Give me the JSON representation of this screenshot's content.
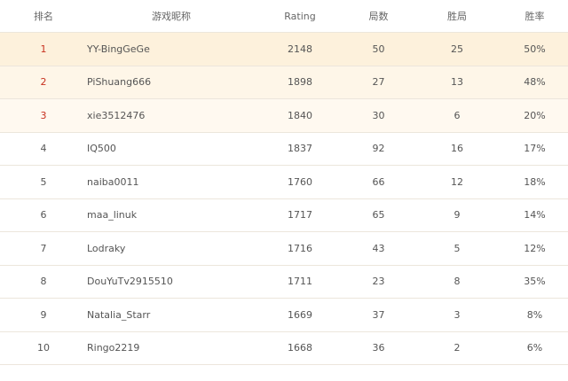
{
  "headers": {
    "rank": "排名",
    "name": "游戏昵称",
    "rating": "Rating",
    "games": "局数",
    "wins": "胜局",
    "rate": "胜率"
  },
  "rows": [
    {
      "rank": "1",
      "name": "YY-BingGeGe",
      "rating": "2148",
      "games": "50",
      "wins": "25",
      "rate": "50%"
    },
    {
      "rank": "2",
      "name": "PiShuang666",
      "rating": "1898",
      "games": "27",
      "wins": "13",
      "rate": "48%"
    },
    {
      "rank": "3",
      "name": "xie3512476",
      "rating": "1840",
      "games": "30",
      "wins": "6",
      "rate": "20%"
    },
    {
      "rank": "4",
      "name": "IQ500",
      "rating": "1837",
      "games": "92",
      "wins": "16",
      "rate": "17%"
    },
    {
      "rank": "5",
      "name": "naiba0011",
      "rating": "1760",
      "games": "66",
      "wins": "12",
      "rate": "18%"
    },
    {
      "rank": "6",
      "name": "maa_linuk",
      "rating": "1717",
      "games": "65",
      "wins": "9",
      "rate": "14%"
    },
    {
      "rank": "7",
      "name": "Lodraky",
      "rating": "1716",
      "games": "43",
      "wins": "5",
      "rate": "12%"
    },
    {
      "rank": "8",
      "name": "DouYuTv2915510",
      "rating": "1711",
      "games": "23",
      "wins": "8",
      "rate": "35%"
    },
    {
      "rank": "9",
      "name": "Natalia_Starr",
      "rating": "1669",
      "games": "37",
      "wins": "3",
      "rate": "8%"
    },
    {
      "rank": "10",
      "name": "Ringo2219",
      "rating": "1668",
      "games": "36",
      "wins": "2",
      "rate": "6%"
    }
  ],
  "colors": {
    "top_rank_text": "#c8311f",
    "top1_bg": "#fdf1dc",
    "top2_bg": "#fef6e8",
    "top3_bg": "#fff9f0"
  }
}
